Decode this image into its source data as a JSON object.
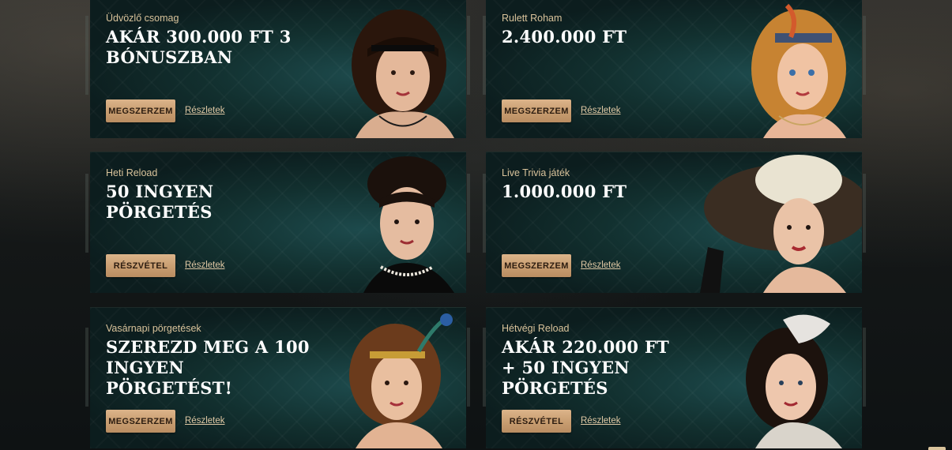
{
  "promos": [
    {
      "eyebrow": "Üdvözlő csomag",
      "title": "AKÁR 300.000 FT 3 BÓNUSZBAN",
      "button": "MEGSZERZEM",
      "link": "Részletek"
    },
    {
      "eyebrow": "Rulett Roham",
      "title": "2.400.000 FT",
      "button": "MEGSZERZEM",
      "link": "Részletek"
    },
    {
      "eyebrow": "Heti Reload",
      "title": "50 INGYEN PÖRGETÉS",
      "button": "RÉSZVÉTEL",
      "link": "Részletek"
    },
    {
      "eyebrow": "Live Trivia játék",
      "title": "1.000.000 FT",
      "button": "MEGSZERZEM",
      "link": "Részletek"
    },
    {
      "eyebrow": "Vasárnapi pörgetések",
      "title": "SZEREZD MEG A 100 INGYEN PÖRGETÉST!",
      "button": "MEGSZERZEM",
      "link": "Részletek"
    },
    {
      "eyebrow": "Hétvégi Reload",
      "title": "AKÁR 220.000 FT + 50 INGYEN PÖRGETÉS",
      "button": "RÉSZVÉTEL",
      "link": "Részletek"
    }
  ],
  "colors": {
    "accent_gold": "#c69b6e",
    "eyebrow": "#d9c39b",
    "card_bg": "#12302f",
    "page_bg": "#0f1314"
  },
  "icons": [
    "portrait-headband-flapper",
    "portrait-blonde-headdress",
    "portrait-updo-pearls",
    "portrait-wide-brim-hat",
    "portrait-peacock-feather-headband",
    "portrait-feather-fascinator"
  ]
}
